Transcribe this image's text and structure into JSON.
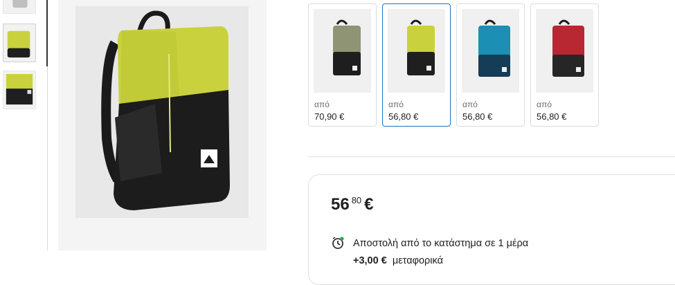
{
  "product": {
    "main_image": "burton-backpack-sulfur-yellow",
    "thumbnails": [
      "gray-top",
      "yellow-side",
      "yellow-front"
    ]
  },
  "variants": [
    {
      "color_name": "olive",
      "from": "από",
      "price": "70,90 €",
      "body": "#8f9474",
      "top": "#a3a683",
      "bottom": "#1e1e1e",
      "selected": false
    },
    {
      "color_name": "yellow",
      "from": "από",
      "price": "56,80 €",
      "body": "#c9d23c",
      "top": "#cdd545",
      "bottom": "#1f1f1f",
      "selected": true
    },
    {
      "color_name": "blue",
      "from": "από",
      "price": "56,80 €",
      "body": "#1b8fb4",
      "top": "#2a9fc4",
      "bottom": "#153d55",
      "selected": false
    },
    {
      "color_name": "red",
      "from": "από",
      "price": "56,80 €",
      "body": "#b82832",
      "top": "#c9323c",
      "bottom": "#262626",
      "selected": false
    }
  ],
  "price_box": {
    "price_int": "56",
    "price_dec": "80",
    "currency": "€",
    "shipping_icon": "clock-icon",
    "shipping_text": "Αποστολή από το κατάστημα σε 1 μέρα",
    "fee_amount": "+3,00 €",
    "fee_label": "μεταφορικά"
  },
  "colors": {
    "selected_border": "#1a73c8",
    "status_dot": "#2fa84f"
  }
}
